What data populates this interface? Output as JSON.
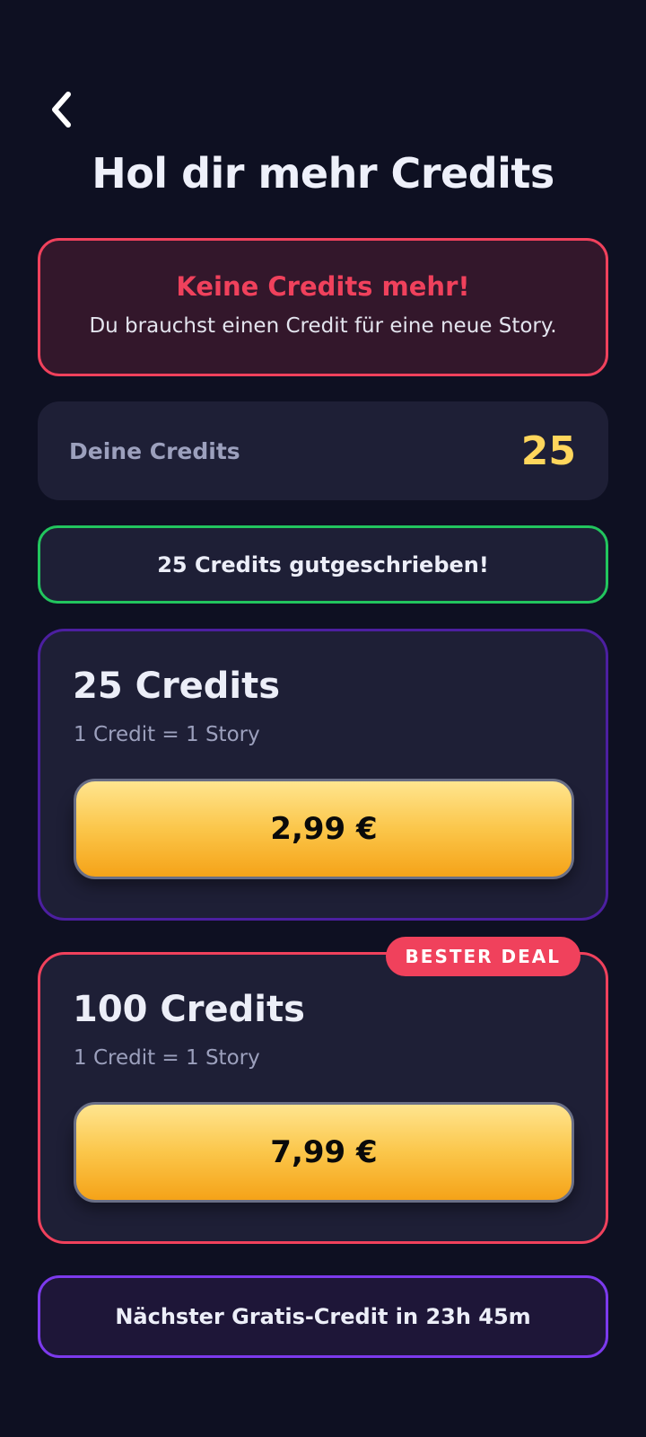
{
  "header": {
    "back_icon": "chevron-left-icon",
    "title": "Hol dir mehr Credits"
  },
  "alert": {
    "title": "Keine Credits mehr!",
    "text": "Du brauchst einen Credit für eine neue Story.",
    "color": "#f0415c"
  },
  "balance": {
    "label": "Deine Credits",
    "value": "25",
    "value_color": "#ffd65c"
  },
  "toast": {
    "text": "25 Credits gutgeschrieben!",
    "color": "#22c55e"
  },
  "packages": [
    {
      "name": "25 Credits",
      "subtitle": "1 Credit = 1 Story",
      "price": "2,99 €",
      "badge": ""
    },
    {
      "name": "100 Credits",
      "subtitle": "1 Credit = 1 Story",
      "price": "7,99 €",
      "badge": "BESTER DEAL"
    }
  ],
  "free_credit": {
    "text": "Nächster Gratis-Credit in 23h 45m",
    "color": "#7c3aed"
  }
}
